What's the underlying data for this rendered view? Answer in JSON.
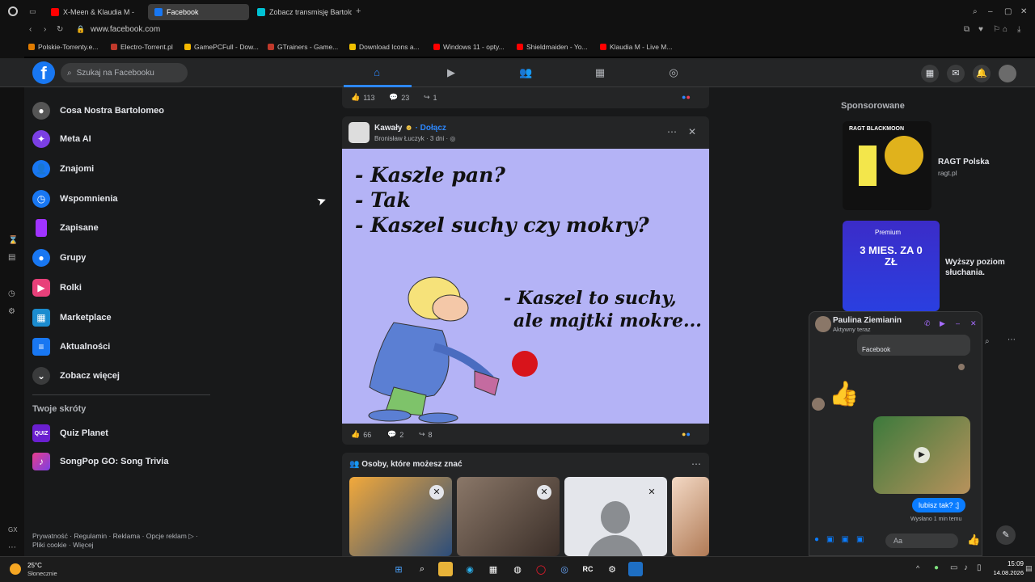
{
  "browser": {
    "tabs": [
      {
        "label": "X-Meen & Klaudia M -",
        "color": "#ff0000"
      },
      {
        "label": "Facebook",
        "color": "#1877f2"
      },
      {
        "label": "Zobacz transmisję Bartolon",
        "color": "#00c2d4"
      }
    ],
    "url": "www.facebook.com",
    "bookmarks": [
      {
        "label": "Polskie-Torrenty.e...",
        "color": "#e07b00"
      },
      {
        "label": "Electro-Torrent.pl",
        "color": "#c0392b"
      },
      {
        "label": "GamePCFull - Dow...",
        "color": "#f5b800"
      },
      {
        "label": "GTrainers - Game...",
        "color": "#c0392b"
      },
      {
        "label": "Download Icons a...",
        "color": "#f0c000"
      },
      {
        "label": "Windows 11 - opty...",
        "color": "#ff0000"
      },
      {
        "label": "Shieldmaiden - Yo...",
        "color": "#ff0000"
      },
      {
        "label": "Klaudia M - Live M...",
        "color": "#ff0000"
      }
    ]
  },
  "header": {
    "logo": "f",
    "search_placeholder": "Szukaj na Facebooku"
  },
  "sidebar": {
    "items": [
      {
        "label": "Cosa Nostra Bartolomeo",
        "icon": "avatar",
        "color": "#444"
      },
      {
        "label": "Meta AI",
        "icon": "meta-ai-icon",
        "color": "#7b3fe4"
      },
      {
        "label": "Znajomi",
        "icon": "friends-icon",
        "color": "#1877f2"
      },
      {
        "label": "Wspomnienia",
        "icon": "clock-icon",
        "color": "#1877f2"
      },
      {
        "label": "Zapisane",
        "icon": "bookmark-icon",
        "color": "#a033ff"
      },
      {
        "label": "Grupy",
        "icon": "groups-icon",
        "color": "#1877f2"
      },
      {
        "label": "Rolki",
        "icon": "reels-icon",
        "color": "#e8407a"
      },
      {
        "label": "Marketplace",
        "icon": "shop-icon",
        "color": "#1b8ccf"
      },
      {
        "label": "Aktualności",
        "icon": "feed-icon",
        "color": "#1877f2"
      },
      {
        "label": "Zobacz więcej",
        "icon": "chevron-down-icon",
        "color": "#3a3b3c"
      }
    ],
    "shortcuts_title": "Twoje skróty",
    "shortcuts": [
      {
        "label": "Quiz Planet",
        "badge": "QUIZ"
      },
      {
        "label": "SongPop GO: Song Trivia",
        "badge": ""
      }
    ],
    "footer": "Prywatność · Regulamin · Reklama · Opcje reklam ▷ · Pliki cookie · Więcej"
  },
  "feed": {
    "top_stats": {
      "likes": "113",
      "comments": "23",
      "shares": "1"
    },
    "post": {
      "group": "Kawały",
      "join": "· Dołącz",
      "author_time": "Bronisław Łuczyk · 3 dni ·",
      "joke_lines": [
        "- Kaszle pan?",
        "- Tak",
        "- Kaszel suchy czy mokry?"
      ],
      "answer_lines": [
        "- Kaszel to suchy,",
        "ale majtki mokre..."
      ],
      "likes": "66",
      "comments": "2",
      "shares": "8"
    },
    "people_title": "Osoby, które możesz znać"
  },
  "right": {
    "sponsored_title": "Sponsorowane",
    "ads": [
      {
        "brand_text": "RAGT BLACKMOON",
        "name": "RAGT Polska",
        "sub": "ragt.pl"
      },
      {
        "brand_text": "Premium",
        "headline": "3 MIES. ZA 0 ZŁ",
        "name": "Wyższy poziom słuchania.",
        "sub": ""
      }
    ]
  },
  "chat": {
    "name": "Paulina Ziemianin",
    "status": "Aktywny teraz",
    "shared_label": "Facebook",
    "my_message": "lubisz tak? ;]",
    "sent": "Wysłano 1 min temu",
    "input_placeholder": "Aa"
  },
  "taskbar": {
    "temp": "25°C",
    "weather": "Słonecznie",
    "time": "15:09",
    "date": "14.08.2026"
  }
}
